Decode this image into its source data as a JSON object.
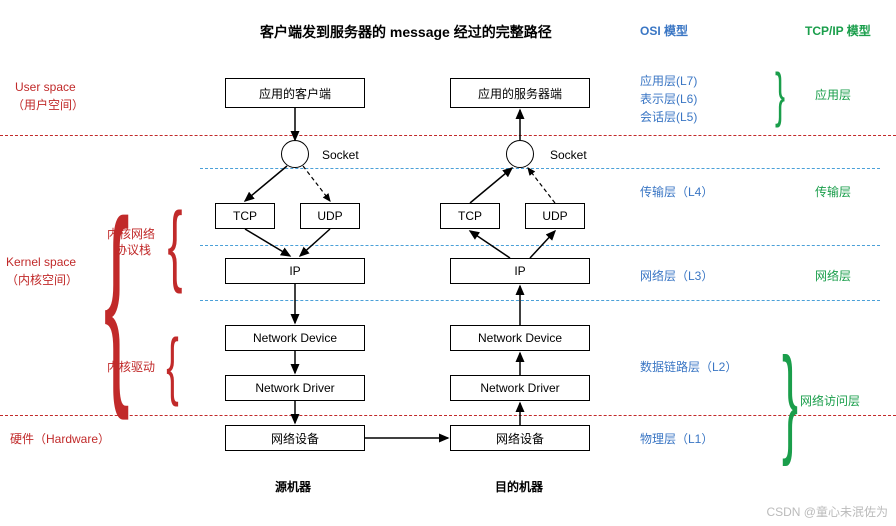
{
  "title": "客户端发到服务器的 message 经过的完整路径",
  "headers": {
    "osi": "OSI 模型",
    "tcp": "TCP/IP 模型"
  },
  "left": {
    "user_space": "User space",
    "user_space_cn": "（用户空间）",
    "kernel_space": "Kernel space",
    "kernel_space_cn": "（内核空间）",
    "hardware": "硬件（Hardware）",
    "kernel_stack": "内核网络",
    "kernel_stack2": "协议栈",
    "kernel_drv": "内核驱动"
  },
  "boxes": {
    "client": "应用的客户端",
    "server": "应用的服务器端",
    "socket": "Socket",
    "tcp": "TCP",
    "udp": "UDP",
    "ip": "IP",
    "ndev": "Network Device",
    "ndrv": "Network Driver",
    "hw": "网络设备"
  },
  "osi": {
    "l7": "应用层(L7)",
    "l6": "表示层(L6)",
    "l5": "会话层(L5)",
    "l4": "传输层（L4）",
    "l3": "网络层（L3）",
    "l2": "数据链路层（L2）",
    "l1": "物理层（L1）"
  },
  "tcpip": {
    "app": "应用层",
    "trans": "传输层",
    "net": "网络层",
    "access": "网络访问层"
  },
  "bottom": {
    "src": "源机器",
    "dst": "目的机器"
  },
  "watermark": "CSDN @童心未泯佐为"
}
